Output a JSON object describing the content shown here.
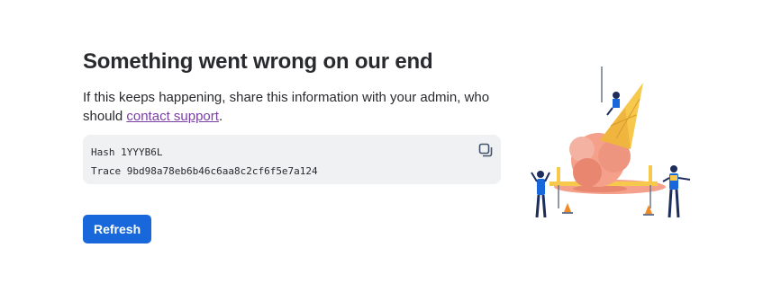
{
  "error": {
    "title": "Something went wrong on our end",
    "message_prefix": "If this keeps happening, share this information with your admin, who should ",
    "support_link": "contact support",
    "message_suffix": ".",
    "hash_label": "Hash",
    "hash_value": "1YYYB6L",
    "trace_label": "Trace",
    "trace_value": "9bd98a78eb6b46c6aa8c2cf6f5e7a124",
    "copy_icon": "copy-icon",
    "refresh_label": "Refresh"
  },
  "colors": {
    "primary_button": "#1868db",
    "link": "#7a3fa3",
    "info_box_bg": "#f0f1f2",
    "ice_cream": "#f4a08a",
    "cone": "#f6c84c"
  },
  "illustration": {
    "name": "melted-ice-cream-cone-illustration"
  }
}
